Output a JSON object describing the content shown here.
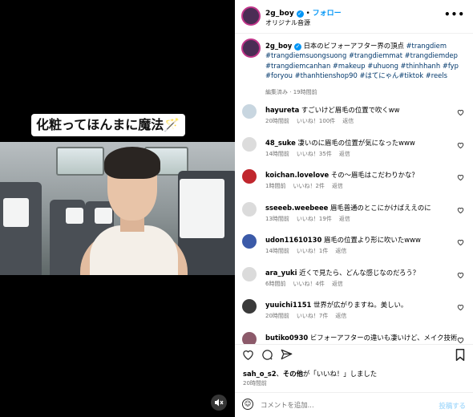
{
  "video": {
    "caption_text": "化粧ってほんまに魔法🪄",
    "mute_icon": "speaker-muted-icon"
  },
  "header": {
    "username": "2g_boy",
    "separator": "•",
    "follow_label": "フォロー",
    "audio_label": "オリジナル音源",
    "more_icon": "•••"
  },
  "post": {
    "username": "2g_boy",
    "text": "日本のビフォーアフター界の頂点",
    "hashtags": "#trangdiem #trangdiemsuongsuong #trangdiemmat #trangdiemdep #trangdiemcanhan #makeup #uhuong #thinhhanh #fyp #foryou #thanhtienshop90 #はてにゃん#tiktok #reels",
    "edited": "編集済み",
    "dot": "·",
    "time": "19時間前"
  },
  "comments": [
    {
      "username": "hayureta",
      "text": "すごいけど眉毛の位置で吹くww",
      "time": "20時間前",
      "likes": "いいね！100件",
      "reply": "返信",
      "avatar_color": "#c8d6e0"
    },
    {
      "username": "48_suke",
      "text": "凄いのに眉毛の位置が気になったwww",
      "time": "14時間前",
      "likes": "いいね！35件",
      "reply": "返信",
      "avatar_color": "#dcdcdc"
    },
    {
      "username": "koichan.lovelove",
      "text": "その〜眉毛はこだわりかな？",
      "time": "1時間前",
      "likes": "いいね！2件",
      "reply": "返信",
      "avatar_color": "#c0262d"
    },
    {
      "username": "sseeeb.weebeee",
      "text": "眉毛普通のとこにかけばええのに",
      "time": "13時間前",
      "likes": "いいね！19件",
      "reply": "返信",
      "avatar_color": "#dbdbdb"
    },
    {
      "username": "udon11610130",
      "text": "眉毛の位置より形に吹いたwww",
      "time": "14時間前",
      "likes": "いいね！1件",
      "reply": "返信",
      "avatar_color": "#3b5aa8"
    },
    {
      "username": "ara_yuki",
      "text": "近くで見たら、どんな感じなのだろう？",
      "time": "6時間前",
      "likes": "いいね！4件",
      "reply": "返信",
      "avatar_color": "#dbdbdb"
    },
    {
      "username": "yuuichi1151",
      "text": "世界が広がりますね。美しい。",
      "time": "20時間前",
      "likes": "いいね！7件",
      "reply": "返信",
      "avatar_color": "#3a3a3a"
    },
    {
      "username": "butiko0930",
      "text": "ビフォーアフターの違いも凄いけど、メイク技術の高さに驚きです👏",
      "time": "",
      "likes": "",
      "reply": "",
      "avatar_color": "#8c5a6a"
    }
  ],
  "actions": {
    "like_icon": "heart-outline-icon",
    "comment_icon": "comment-bubble-icon",
    "share_icon": "paper-plane-icon",
    "save_icon": "bookmark-icon"
  },
  "likes_summary": {
    "user": "sah_o_s2",
    "connector": "、",
    "others": "その他",
    "suffix": "が「いいね！」しました"
  },
  "post_time": "20時間前",
  "comment_box": {
    "placeholder": "コメントを追加...",
    "post_label": "投稿する",
    "emoji_icon": "smiley-icon"
  },
  "colors": {
    "accent": "#0095f6",
    "hashtag": "#00376b",
    "secondary_text": "#737373",
    "post_disabled": "#b2dffc"
  }
}
